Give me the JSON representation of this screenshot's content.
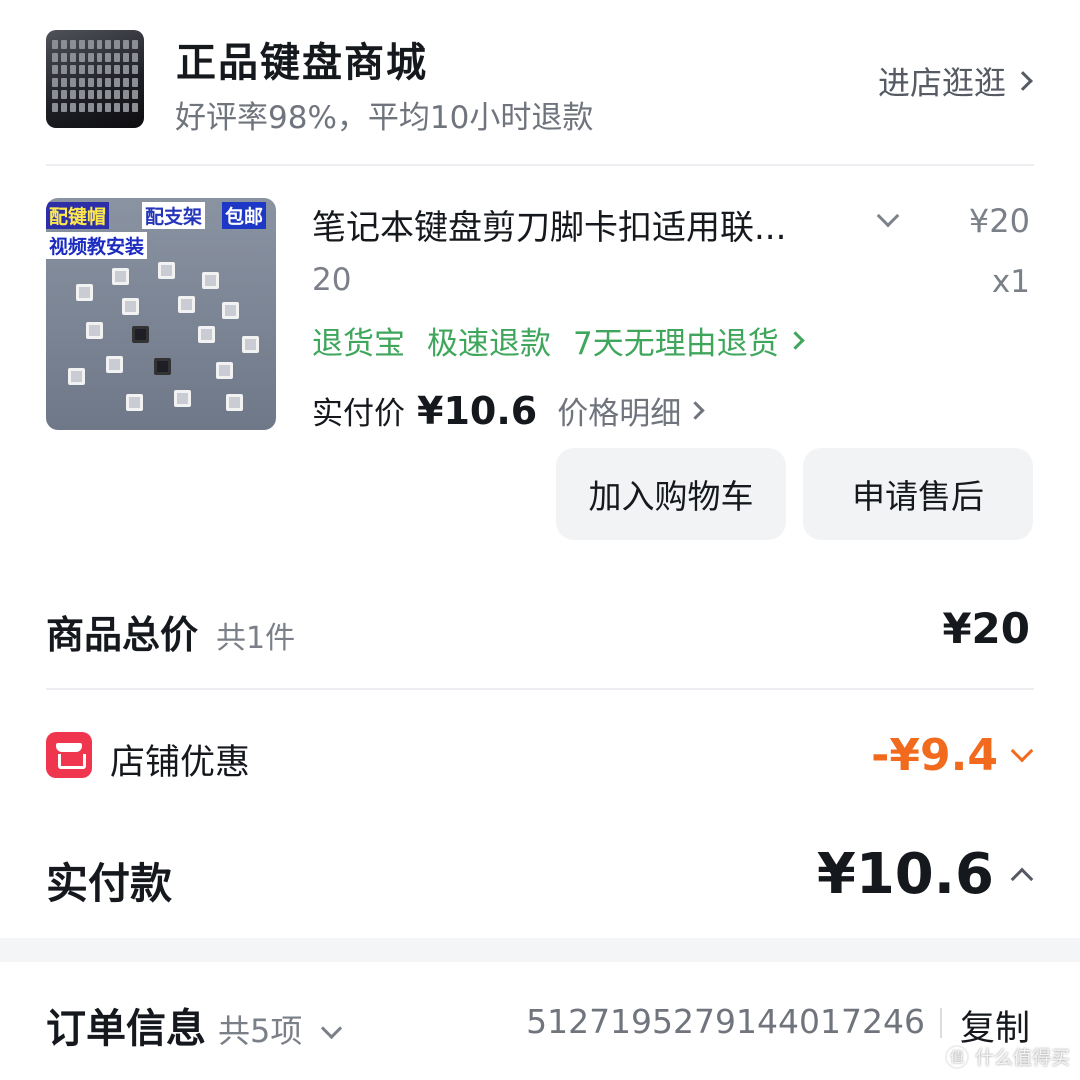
{
  "shop": {
    "name": "正品键盘商城",
    "rating_text": "好评率98%，平均10小时退款",
    "visit_label": "进店逛逛"
  },
  "product": {
    "image_captions": [
      "配键帽",
      "配支架",
      "包邮",
      "视频教安装"
    ],
    "title": "笔记本键盘剪刀脚卡扣适用联...",
    "price": "¥20",
    "spec": "20",
    "quantity": "x1",
    "services": [
      "退货宝",
      "极速退款",
      "7天无理由退货"
    ],
    "paid_label": "实付价",
    "paid_value": "¥10.6",
    "price_detail_label": "价格明细"
  },
  "actions": {
    "add_to_cart": "加入购物车",
    "after_sales": "申请售后"
  },
  "summary": {
    "total_label": "商品总价",
    "total_count": "共1件",
    "total_value": "¥20",
    "store_discount_label": "店铺优惠",
    "store_discount_value": "-¥9.4",
    "pay_label": "实付款",
    "pay_value": "¥10.6"
  },
  "order": {
    "label": "订单信息",
    "count": "共5项",
    "number": "5127195279144017246",
    "copy_label": "复制"
  },
  "watermark": "什么值得买",
  "colors": {
    "service_green": "#3fa65c",
    "discount_orange": "#f26a1e",
    "store_icon_red": "#f0364f"
  }
}
